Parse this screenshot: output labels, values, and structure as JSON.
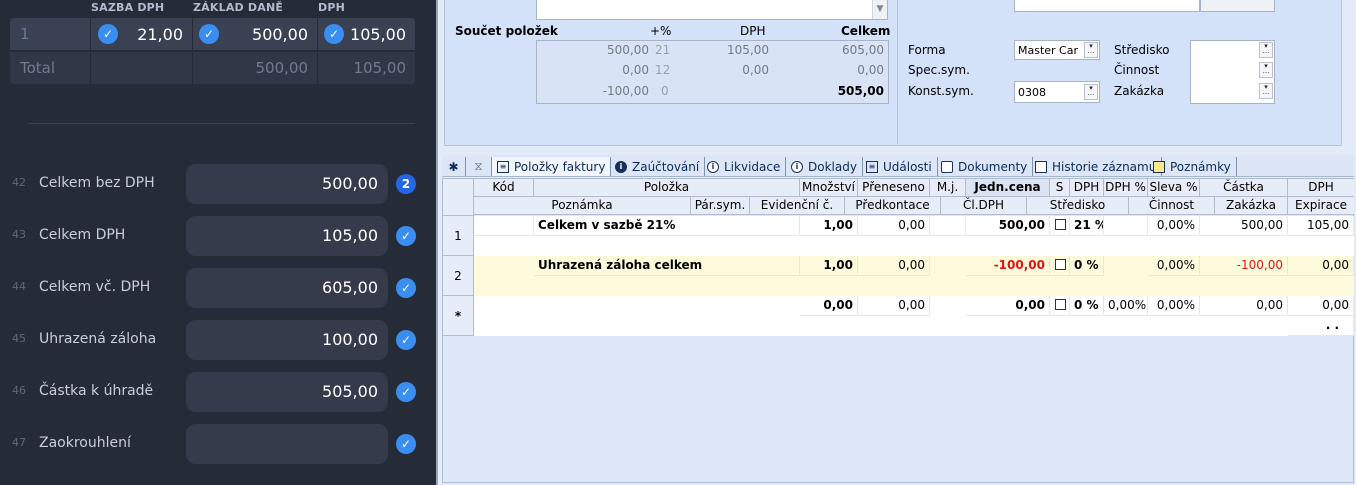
{
  "vat_table": {
    "headers": [
      "SAZBA DPH",
      "ZÁKLAD DANĚ",
      "DPH"
    ],
    "row": {
      "index": "1",
      "rate": "21,00",
      "base": "500,00",
      "vat": "105,00"
    },
    "total": {
      "label": "Total",
      "base": "500,00",
      "vat": "105,00"
    }
  },
  "summary": [
    {
      "num": "42",
      "label": "Celkem bez DPH",
      "value": "500,00",
      "badge": "2"
    },
    {
      "num": "43",
      "label": "Celkem DPH",
      "value": "105,00"
    },
    {
      "num": "44",
      "label": "Celkem vč. DPH",
      "value": "605,00"
    },
    {
      "num": "45",
      "label": "Uhrazená záloha",
      "value": "100,00"
    },
    {
      "num": "46",
      "label": "Částka k úhradě",
      "value": "505,00"
    },
    {
      "num": "47",
      "label": "Zaokrouhlení",
      "value": ""
    }
  ],
  "top": {
    "sum_title": "Součet položek",
    "sum_headers": [
      "+%",
      "DPH",
      "Celkem"
    ],
    "sum_rows": [
      {
        "base": "500,00",
        "pct": "21",
        "vat": "105,00",
        "total": "605,00"
      },
      {
        "base": "0,00",
        "pct": "12",
        "vat": "0,00",
        "total": "0,00"
      },
      {
        "base": "-100,00",
        "pct": "0",
        "vat": "",
        "total": "505,00"
      }
    ],
    "forma_label": "Forma",
    "forma_value": "Master Car",
    "spec_label": "Spec.sym.",
    "konst_label": "Konst.sym.",
    "konst_value": "0308",
    "stredisko_label": "Středisko",
    "cinnost_label": "Činnost",
    "zakazka_label": "Zakázka"
  },
  "tabs": [
    "Položky faktury",
    "Zaúčtování",
    "Likvidace",
    "Doklady",
    "Události",
    "Dokumenty",
    "Historie záznamu",
    "Poznámky"
  ],
  "grid": {
    "header1": [
      "Kód",
      "Položka",
      "Množství",
      "Přeneseno",
      "M.j.",
      "Jedn.cena",
      "S",
      "DPH",
      "DPH %",
      "Sleva %",
      "Částka",
      "DPH"
    ],
    "header2": [
      "Poznámka",
      "Pár.sym.",
      "Evidenční č.",
      "Předkontace",
      "Čl.DPH",
      "Středisko",
      "Činnost",
      "Zakázka",
      "Expirace"
    ],
    "rows": [
      {
        "sel": "1",
        "item": "Celkem v sazbě 21%",
        "qty": "1,00",
        "trans": "0,00",
        "price": "500,00",
        "vat": "21 %",
        "vatpct": "",
        "disc": "0,00%",
        "amount": "500,00",
        "dph": "105,00"
      },
      {
        "sel": "2",
        "item": "Uhrazená záloha celkem",
        "qty": "1,00",
        "trans": "0,00",
        "price": "-100,00",
        "vat": "0 %",
        "vatpct": "",
        "disc": "0,00%",
        "amount": "-100,00",
        "dph": "0,00"
      },
      {
        "sel": "*",
        "item": "",
        "qty": "0,00",
        "trans": "0,00",
        "price": "0,00",
        "vat": "0 %",
        "vatpct": "0,00%",
        "disc": "0,00%",
        "amount": "0,00",
        "dph": "0,00"
      }
    ],
    "trailing": ". ."
  }
}
